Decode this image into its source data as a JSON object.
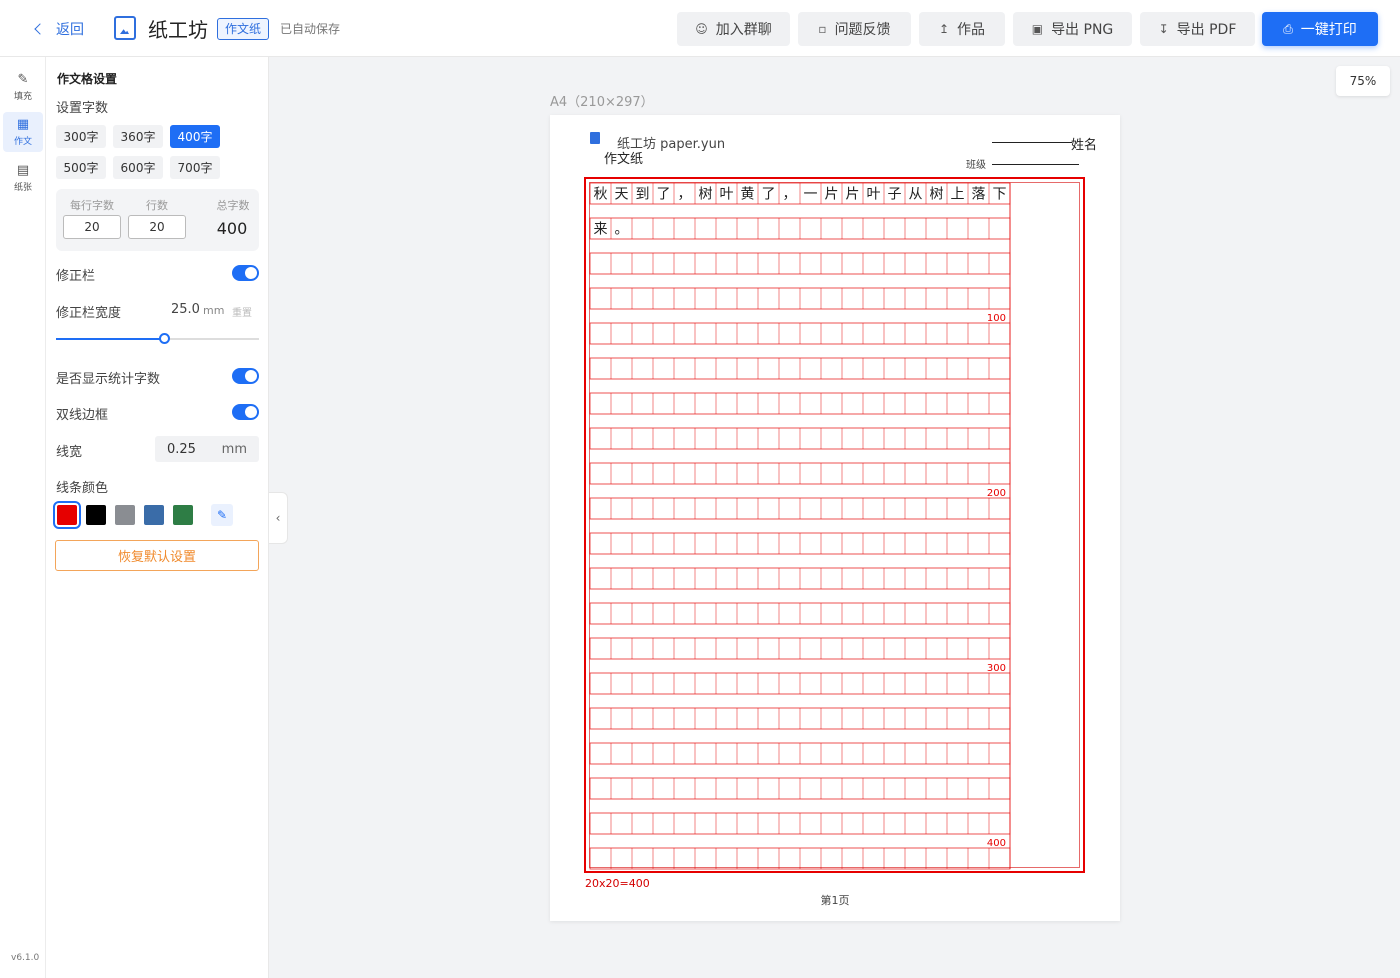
{
  "header": {
    "back_label": "返回",
    "app_title": "纸工坊",
    "doc_type": "作文纸",
    "save_status": "已自动保存",
    "buttons": {
      "join_group": "加入群聊",
      "feedback": "问题反馈",
      "works": "作品",
      "export_png": "导出 PNG",
      "export_pdf": "导出 PDF",
      "print": "一键打印"
    }
  },
  "rail": {
    "items": [
      {
        "label": "填充",
        "icon": "pencil-icon"
      },
      {
        "label": "作文",
        "icon": "grid-icon"
      },
      {
        "label": "纸张",
        "icon": "document-icon"
      }
    ],
    "version": "v6.1.0"
  },
  "settings": {
    "title": "作文格设置",
    "word_count_label": "设置字数",
    "presets": [
      "300字",
      "360字",
      "400字",
      "500字",
      "600字",
      "700字"
    ],
    "active_preset": "400字",
    "per_row_label": "每行字数",
    "rows_label": "行数",
    "total_label": "总字数",
    "per_row_value": "20",
    "rows_value": "20",
    "total_value": "400",
    "correction_label": "修正栏",
    "correction_width_label": "修正栏宽度",
    "correction_width_value": "25.0",
    "correction_width_unit": "mm",
    "correction_width_reset": "重置",
    "correction_width_fraction": 0.53,
    "show_count_label": "是否显示统计字数",
    "double_border_label": "双线边框",
    "line_width_label": "线宽",
    "line_width_value": "0.25",
    "line_width_unit": "mm",
    "line_color_label": "线条颜色",
    "colors": [
      "#e60000",
      "#000000",
      "#8a8d92",
      "#3a6ca8",
      "#2e7d45"
    ],
    "selected_color": "#e60000",
    "reset_label": "恢复默认设置"
  },
  "canvas": {
    "zoom": "75%",
    "paper_size": "A4（210×297）",
    "brand": "纸工坊 paper.yun",
    "sheet_title": "作文纸",
    "name_label": "姓名",
    "class_label": "班级",
    "grid_color": "#e60000",
    "grid": {
      "cols": 20,
      "rows": 20,
      "milestones": [
        "100",
        "200",
        "300",
        "400"
      ],
      "lines": [
        "秋天到了，树叶黄了，一片片叶子从树上落下",
        "来。"
      ]
    },
    "caption": "20x20=400",
    "page_label": "第1页"
  }
}
